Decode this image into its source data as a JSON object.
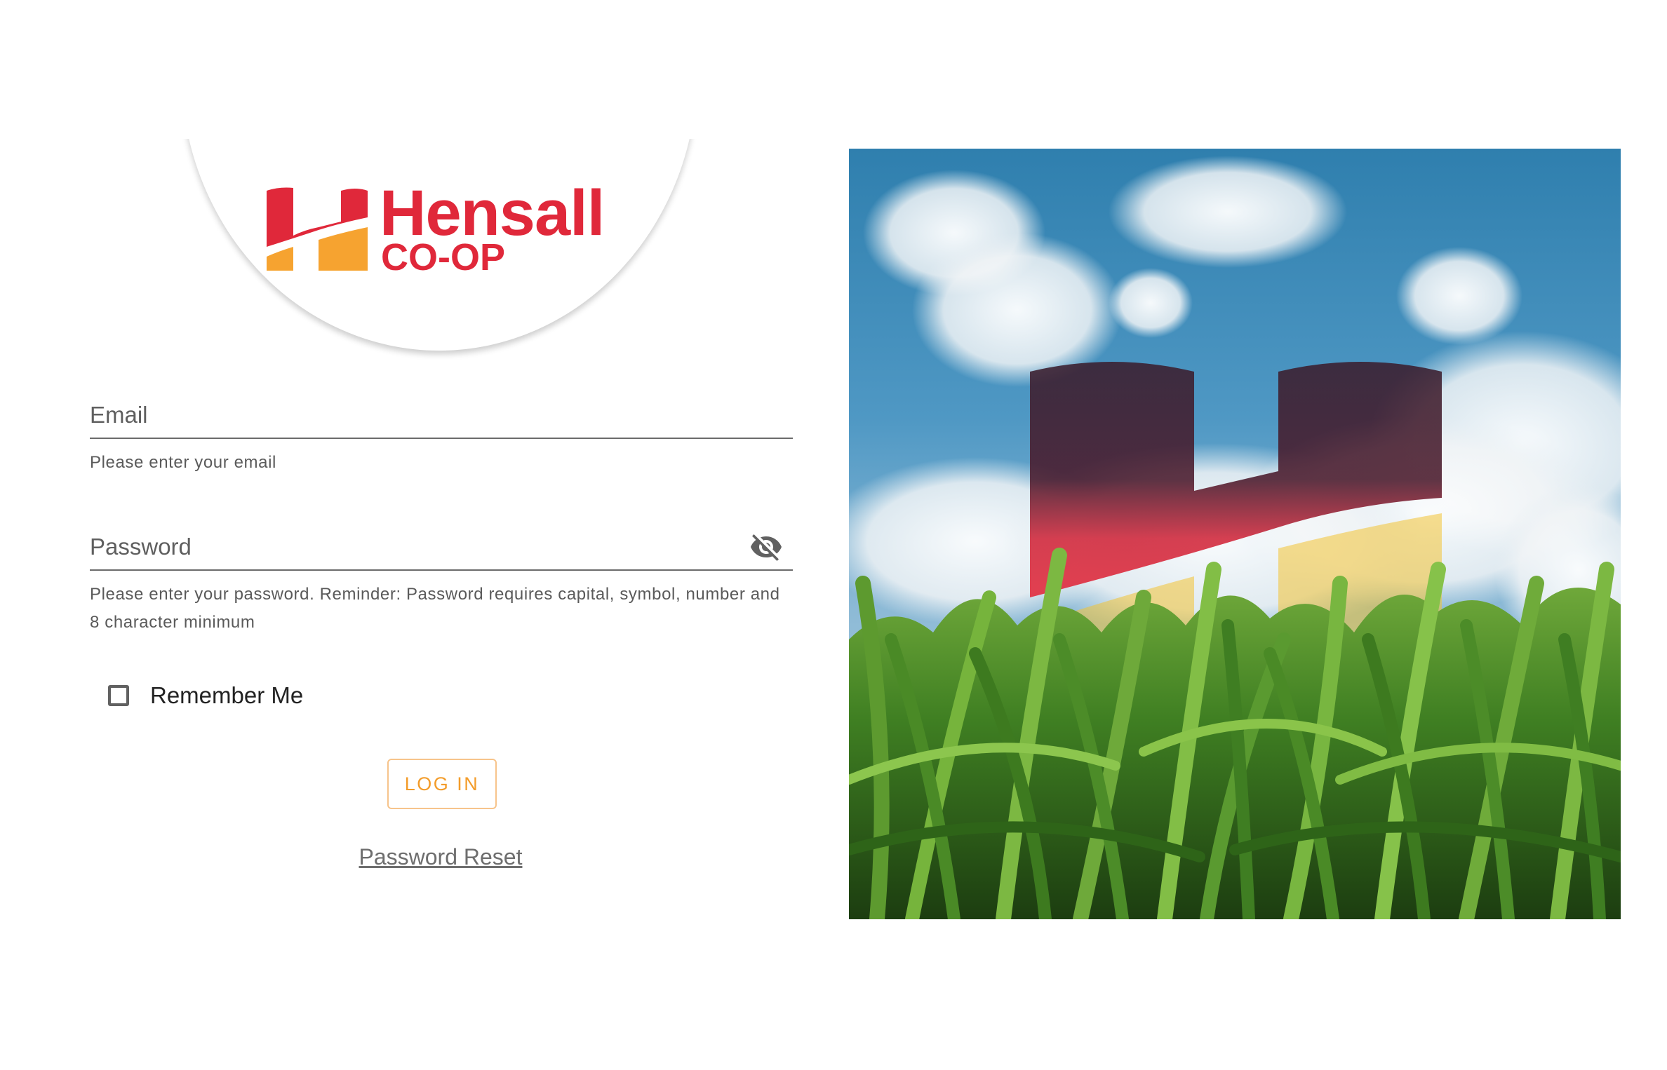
{
  "brand": {
    "name": "Hensall",
    "subtitle": "CO-OP",
    "logo_icon": "hensall-h-logo-icon",
    "colors": {
      "red": "#e0283a",
      "orange": "#f6a330"
    }
  },
  "form": {
    "email": {
      "placeholder": "Email",
      "value": "",
      "hint": "Please enter your email"
    },
    "password": {
      "placeholder": "Password",
      "value": "",
      "hint": "Please enter your password. Reminder: Password requires capital, symbol, number and 8 character minimum",
      "visibility_icon": "eye-off-icon"
    },
    "remember_me": {
      "label": "Remember Me",
      "checked": false
    },
    "login_label": "LOG IN",
    "reset_label": "Password Reset"
  },
  "hero": {
    "description_icon": "cornfield-sky-hero-image",
    "accent": "#f39c2a"
  }
}
